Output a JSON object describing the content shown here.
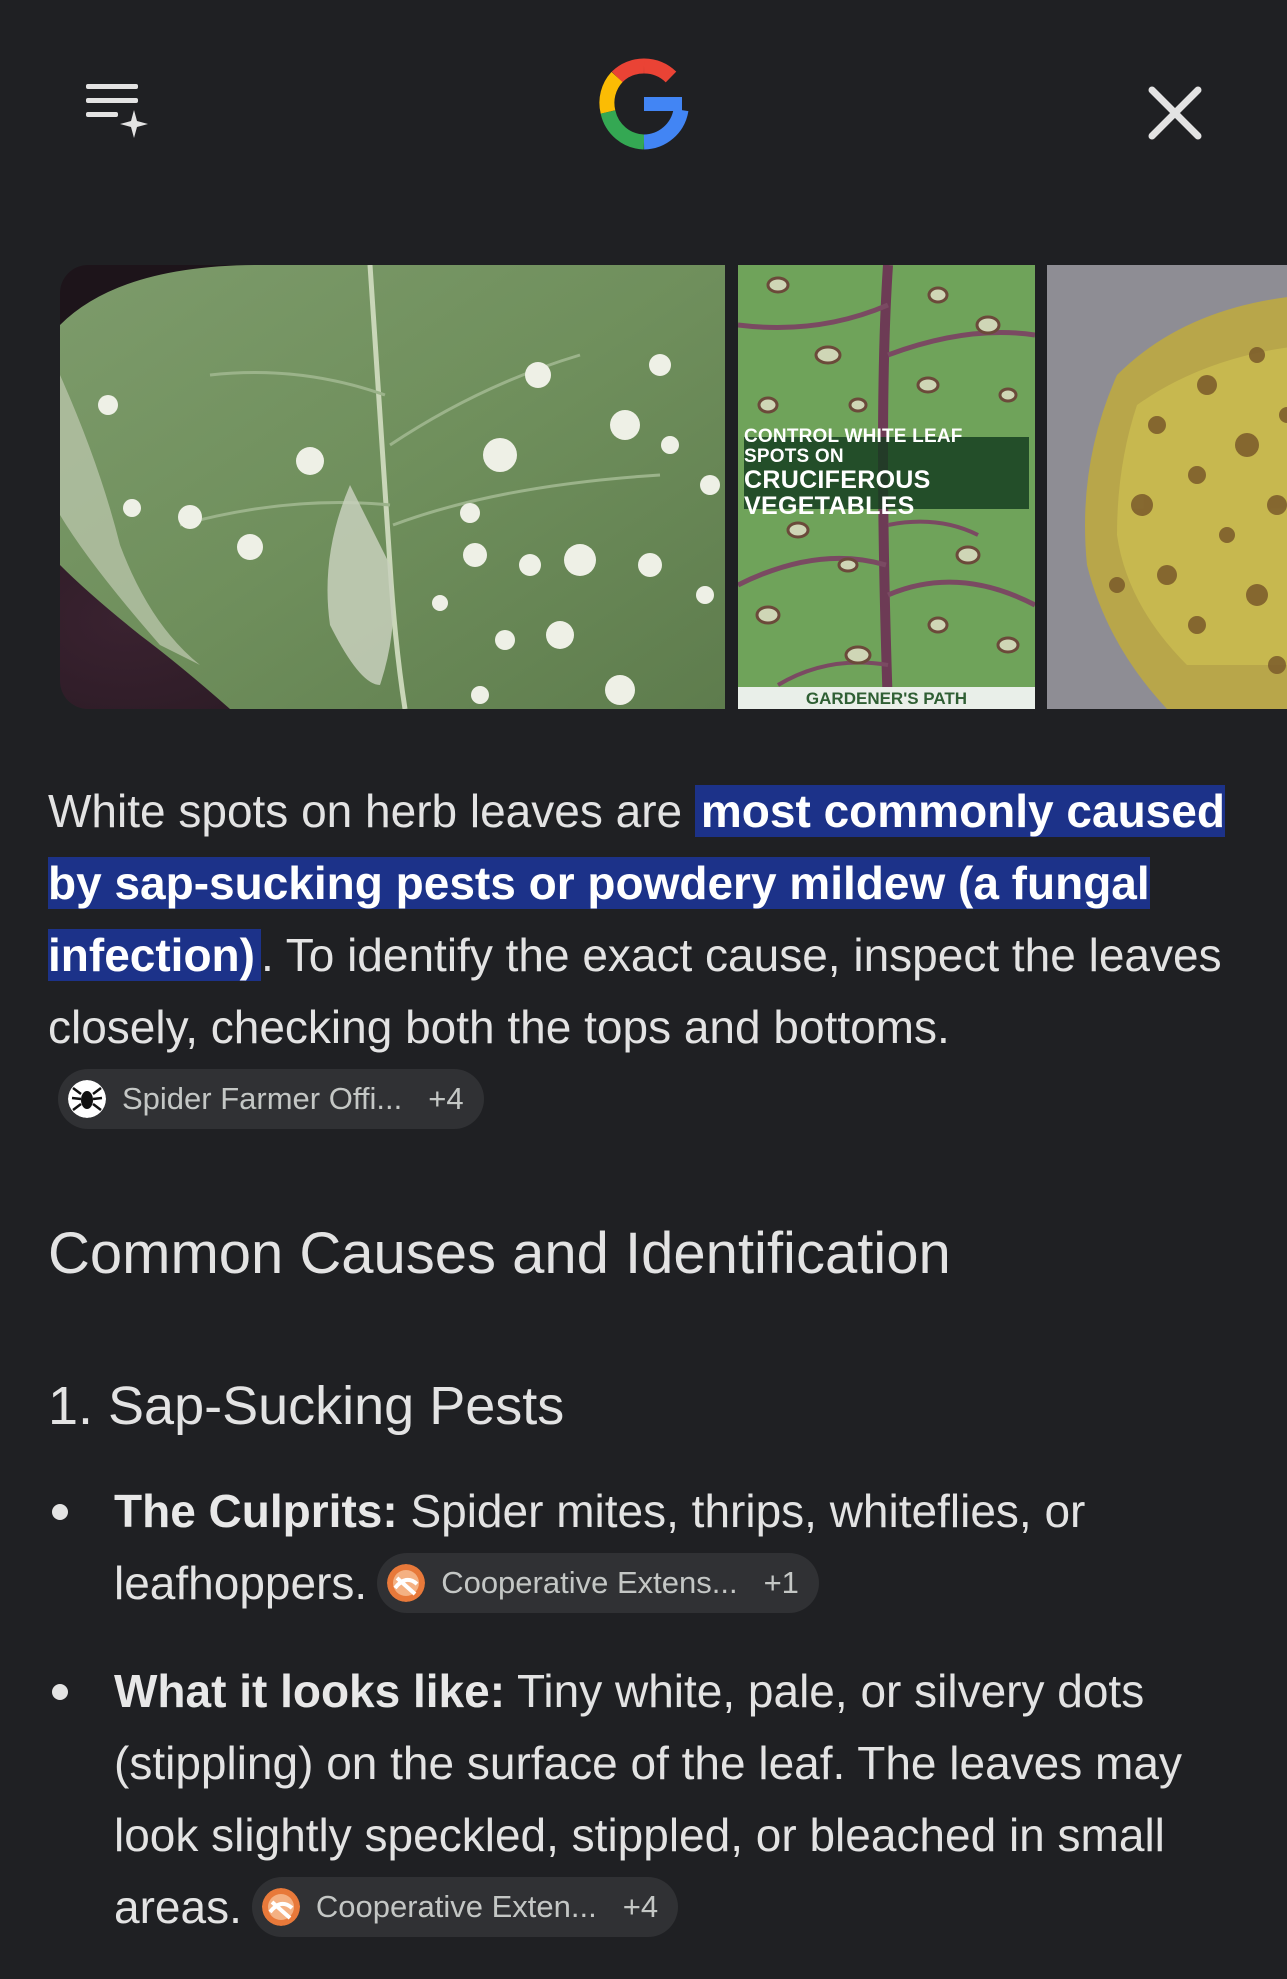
{
  "header": {
    "menu_icon": "list-sparkle-icon",
    "logo": "google-g-logo",
    "close_icon": "close-icon"
  },
  "images": [
    {
      "name": "leaf-white-spots-image"
    },
    {
      "name": "cruciferous-leaf-spots-image",
      "overlay_line1": "CONTROL WHITE LEAF SPOTS ON",
      "overlay_line2": "CRUCIFEROUS VEGETABLES",
      "footer": "GARDENER'S PATH"
    },
    {
      "name": "yellow-leaf-brown-spots-image"
    }
  ],
  "summary": {
    "before": "White spots on herb leaves are ",
    "highlight": "most commonly caused by sap-sucking pests or powdery mildew (a fungal infection)",
    "after": ". To identify the exact cause, inspect the leaves closely, checking both the tops and bottoms.",
    "source": {
      "label": "Spider Farmer Offi...",
      "count": "+4"
    }
  },
  "section_title": "Common Causes and Identification",
  "subsection_title": "1. Sap-Sucking Pests",
  "bullets": [
    {
      "label": "The Culprits:",
      "text": " Spider mites, thrips, whiteflies, or leafhoppers.",
      "source": {
        "label": "Cooperative Extens...",
        "count": "+1"
      }
    },
    {
      "label": "What it looks like:",
      "text": " Tiny white, pale, or silvery dots (stippling) on the surface of the leaf. The leaves may look slightly speckled, stippled, or bleached in small areas.",
      "source": {
        "label": "Cooperative Exten...",
        "count": "+4"
      }
    }
  ],
  "colors": {
    "background": "#1f2023",
    "highlight": "#1c3289",
    "chip": "#303134"
  }
}
